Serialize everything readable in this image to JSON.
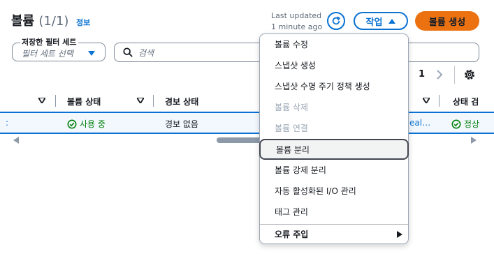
{
  "header": {
    "title": "볼륨",
    "count": "(1/1)",
    "info_link": "정보",
    "last_updated_line1": "Last updated",
    "last_updated_line2": "1 minute ago",
    "actions_label": "작업",
    "create_label": "볼륨 생성"
  },
  "filters": {
    "saved_filter_label": "저장한 필터 세트",
    "saved_filter_placeholder": "필터 세트 선택",
    "search_placeholder": "검색"
  },
  "pagination": {
    "page": "1"
  },
  "table": {
    "columns": [
      "볼륨 상태",
      "경보 상태",
      "상태 검"
    ],
    "row": {
      "left_fragment": ":",
      "volume_state": "사용 중",
      "alarm_state": "경보 없음",
      "link_fragment": "eal…",
      "status_check": "정상"
    }
  },
  "menu": {
    "items": [
      {
        "label": "볼륨 수정",
        "state": "enabled"
      },
      {
        "label": "스냅샷 생성",
        "state": "enabled"
      },
      {
        "label": "스냅샷 수명 주기 정책 생성",
        "state": "enabled"
      },
      {
        "label": "볼륨 삭제",
        "state": "disabled"
      },
      {
        "label": "볼륨 연결",
        "state": "disabled"
      },
      {
        "label": "볼륨 분리",
        "state": "highlighted"
      },
      {
        "label": "볼륨 강제 분리",
        "state": "enabled"
      },
      {
        "label": "자동 활성화된 I/O 관리",
        "state": "enabled"
      },
      {
        "label": "태그 관리",
        "state": "enabled"
      }
    ],
    "group_label": "오류 주입"
  },
  "colors": {
    "link_blue": "#0972d3",
    "primary_orange": "#ec7211",
    "success_green": "#037f0c",
    "disabled_gray": "#9ba7b6"
  },
  "icons": [
    "refresh-icon",
    "caret-up-icon",
    "caret-down-icon",
    "search-icon",
    "chevron-right-icon",
    "settings-icon",
    "check-circle-icon",
    "sort-icon",
    "submenu-arrow-icon"
  ]
}
